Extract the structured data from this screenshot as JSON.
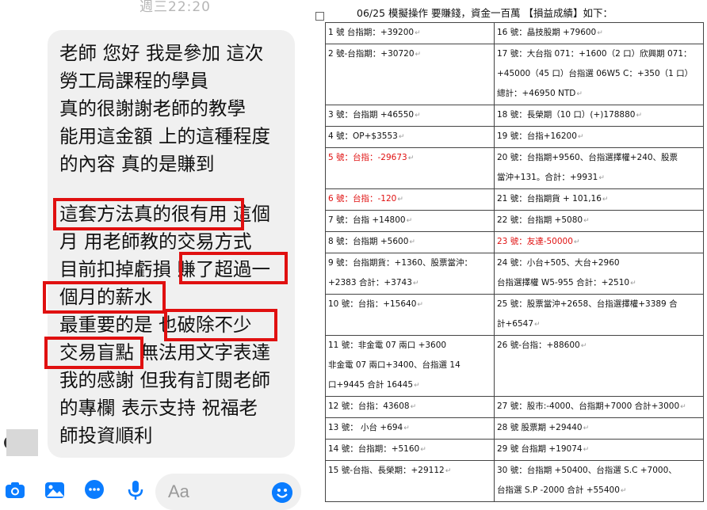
{
  "chat": {
    "timestamp": "週三22:20",
    "message_lines": [
      "老師 您好 我是參加 這次",
      "勞工局課程的學員",
      " 真的很謝謝老師的教學",
      "能用這金額 上的這種程度",
      "的內容 真的是賺到",
      "這套方法真的很有用 這個",
      "月 用老師教的交易方式",
      "目前扣掉虧損 賺了超過一",
      "個月的薪水",
      "最重要的是 也破除不少",
      "交易盲點 無法用文字表達",
      "我的感謝 但我有訂閱老師",
      "的專欄 表示支持 祝福老",
      "師投資順利"
    ],
    "highlighted_phrases": [
      "這套方法真的很有用",
      "賺了超過一",
      "個月的薪水",
      "也破除不少",
      "交易盲點"
    ],
    "input_placeholder": "Aa",
    "icons": [
      "camera-icon",
      "photo-icon",
      "messenger-icon",
      "microphone-icon",
      "emoji-icon"
    ],
    "accent_color": "#0a7cff",
    "highlight_color": "#e01010"
  },
  "document": {
    "heading": "06/25 模擬操作 要賺錢，資金一百萬 【損益成績】如下：",
    "rows": [
      {
        "left": [
          "1 號 台指期：+39200"
        ],
        "right": [
          "16 號：晶技股期 +79600"
        ]
      },
      {
        "left": [
          "2 號-台指期：+30720"
        ],
        "right": [
          "17 號：大台指 071：+1600（2 口）欣興期 071：",
          "+45000（45 口）台指選 06W5 C：+350（1 口）",
          "總計：+46950 NTD"
        ]
      },
      {
        "left": [
          "3 號：台指期 +46550"
        ],
        "right": [
          "18 號：長榮期（10 口）(+)178880"
        ]
      },
      {
        "left": [
          "4 號：OP+$3553"
        ],
        "right": [
          "19 號：台指+16200"
        ]
      },
      {
        "left": [
          "5 號：台指：-29673"
        ],
        "left_red": true,
        "right": [
          "20 號：台指期+9560、台指選擇權+240、股票",
          "當沖+131。合計：+9931"
        ]
      },
      {
        "left": [
          "6 號：台指：-120"
        ],
        "left_red": true,
        "right": [
          "21 號：台指期貨 + 101,16"
        ]
      },
      {
        "left": [
          "7 號：台指 +14800"
        ],
        "right": [
          "22 號：台指期 +5080"
        ]
      },
      {
        "left": [
          "8 號：台指期 +5600"
        ],
        "right": [
          "23 號：友達-50000"
        ],
        "right_red": true
      },
      {
        "left": [
          "9 號：台指期貨：+1360、股票當沖：",
          "+2383 合計：+3743"
        ],
        "right": [
          "24 號：小台+505、大台+2960",
          "台指選擇權 W5-955 合計：+2510"
        ]
      },
      {
        "left": [
          "10 號：台指：+15640"
        ],
        "right": [
          "25 號：股票當沖+2658、台指選擇權+3389 合",
          "計+6547"
        ]
      },
      {
        "left": [
          "11 號：非金電 07 兩口 +3600",
          "非金電 07 兩口+3400、台指選 14",
          "口+9445 合計 16445"
        ],
        "right": [
          "26 號-台指：+88600"
        ]
      },
      {
        "left": [
          "12 號：台指：43608"
        ],
        "right": [
          "27 號：股市:-4000、台指期+7000 合計+3000"
        ]
      },
      {
        "left": [
          "13 號： 小台 +694"
        ],
        "right": [
          "28 號 股票期 +29440"
        ]
      },
      {
        "left": [
          "14 號：台指期：+5160"
        ],
        "right": [
          "29 號 台指期 +19074"
        ]
      },
      {
        "left": [
          "15 號-台指、長榮期：+29112"
        ],
        "right": [
          "30 號：台指期 +50400、台指選 S.C +7000、",
          "台指選 S.P -2000 合計 +55400"
        ]
      }
    ],
    "loss_color": "#e01010"
  }
}
